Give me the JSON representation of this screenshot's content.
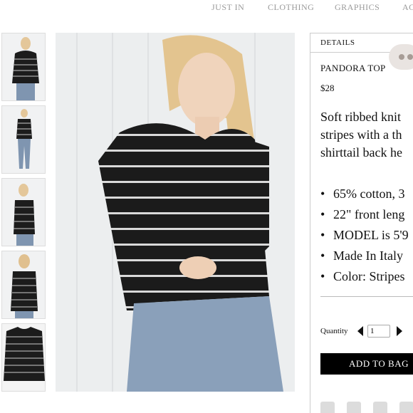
{
  "nav": {
    "items": [
      "JUST IN",
      "CLOTHING",
      "GRAPHICS",
      "AC"
    ]
  },
  "thumbnails": [
    {
      "alt": "front-view-thumbnail"
    },
    {
      "alt": "full-body-thumbnail"
    },
    {
      "alt": "side-view-thumbnail"
    },
    {
      "alt": "back-view-thumbnail"
    },
    {
      "alt": "flat-lay-thumbnail"
    }
  ],
  "details": {
    "tab_label": "DETAILS",
    "title": "PANDORA TOP",
    "price": "$28",
    "description_lines": [
      "Soft ribbed knit",
      "stripes with a th",
      "shirttail back he"
    ],
    "bullets": [
      "65% cotton, 3",
      "22\" front leng",
      "MODEL is 5'9",
      "Made In Italy",
      "Color: Stripes"
    ],
    "quantity_label": "Quantity",
    "quantity_value": "1",
    "add_button": "ADD TO BAG"
  },
  "social_icons": [
    "facebook-icon",
    "twitter-icon",
    "pinterest-icon",
    "tumblr-icon"
  ],
  "colors": {
    "nav_text": "#9a9a9a",
    "button_bg": "#000000",
    "chat_bubble": "#e9e4e1"
  }
}
